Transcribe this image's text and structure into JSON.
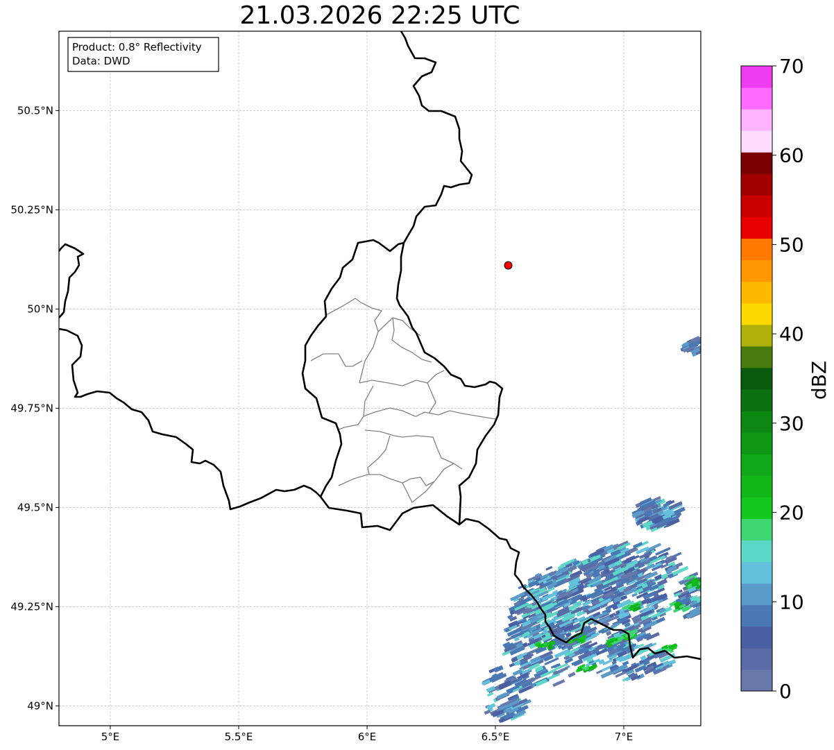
{
  "title": "21.03.2026 22:25 UTC",
  "info": {
    "product": "Product: 0.8° Reflectivity",
    "source": "Data: DWD"
  },
  "map": {
    "lon_range": [
      4.8,
      7.3
    ],
    "lat_range": [
      48.95,
      50.7
    ],
    "lon_ticks": [
      {
        "value": 5.0,
        "label": "5°E"
      },
      {
        "value": 5.5,
        "label": "5.5°E"
      },
      {
        "value": 6.0,
        "label": "6°E"
      },
      {
        "value": 6.5,
        "label": "6.5°E"
      },
      {
        "value": 7.0,
        "label": "7°E"
      }
    ],
    "lat_ticks": [
      {
        "value": 50.5,
        "label": "50.5°N"
      },
      {
        "value": 50.25,
        "label": "50.25°N"
      },
      {
        "value": 50.0,
        "label": "50°N"
      },
      {
        "value": 49.75,
        "label": "49.75°N"
      },
      {
        "value": 49.5,
        "label": "49.5°N"
      },
      {
        "value": 49.25,
        "label": "49.25°N"
      },
      {
        "value": 49.0,
        "label": "49°N"
      }
    ],
    "grid": true,
    "marker": {
      "lon": 6.55,
      "lat": 50.11,
      "color": "#ff0000"
    }
  },
  "colorbar": {
    "label": "dBZ",
    "min": 0,
    "max": 70,
    "step": 2.5,
    "tick_labels": [
      "0",
      "10",
      "20",
      "30",
      "40",
      "50",
      "60",
      "70"
    ],
    "colors": [
      "#6779aa",
      "#5a6ca6",
      "#4b60a3",
      "#4a78b5",
      "#5a9bc9",
      "#64c1de",
      "#5ed8c6",
      "#3ed670",
      "#12c81e",
      "#12b81a",
      "#10a818",
      "#0e9816",
      "#0c8813",
      "#0a7010",
      "#0a5a0e",
      "#487a0e",
      "#b0b00a",
      "#ffd800",
      "#ffb800",
      "#ff9800",
      "#ff7800",
      "#e80000",
      "#c80000",
      "#a00000",
      "#780000",
      "#ffdcff",
      "#ffb4ff",
      "#ff6cff",
      "#f03cf0"
    ]
  }
}
